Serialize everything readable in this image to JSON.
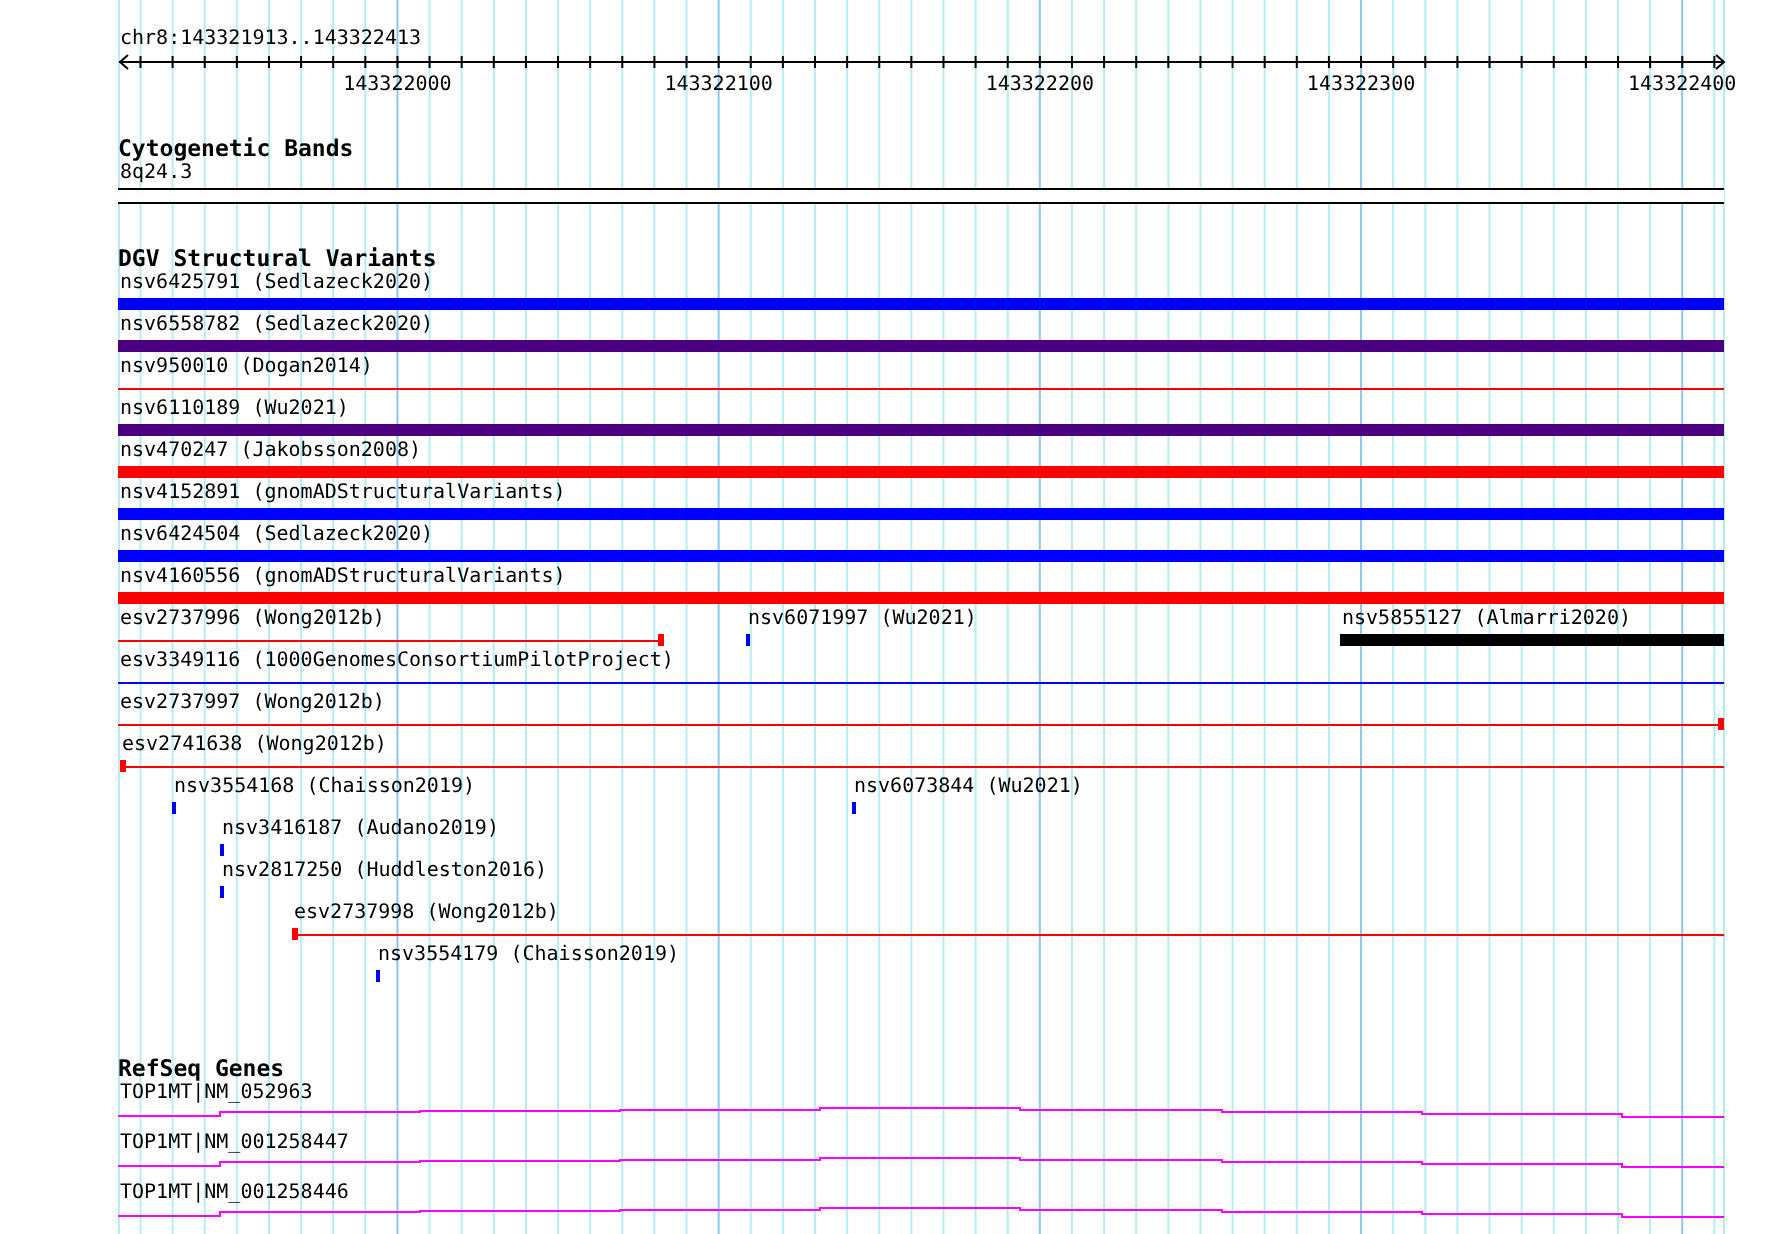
{
  "position": "chr8:143321913..143322413",
  "ruler": {
    "labels": [
      "143322000",
      "143322100",
      "143322200",
      "143322300",
      "143322400"
    ]
  },
  "tracks": [
    {
      "kind": "cytoband",
      "title": "Cytogenetic Bands",
      "items": [
        {
          "label": "8q24.3"
        }
      ]
    },
    {
      "kind": "variants",
      "title": "DGV Structural Variants",
      "rows": [
        {
          "features": [
            {
              "label": "nsv6425791 (Sedlazeck2020)",
              "kind": "bar",
              "color": "#0000ff"
            }
          ]
        },
        {
          "features": [
            {
              "label": "nsv6558782 (Sedlazeck2020)",
              "kind": "bar",
              "color": "#4b0082"
            }
          ]
        },
        {
          "features": [
            {
              "label": "nsv950010 (Dogan2014)",
              "kind": "line",
              "color": "#ff0000"
            }
          ]
        },
        {
          "features": [
            {
              "label": "nsv6110189 (Wu2021)",
              "kind": "bar",
              "color": "#4b0082"
            }
          ]
        },
        {
          "features": [
            {
              "label": "nsv470247 (Jakobsson2008)",
              "kind": "bar",
              "color": "#ff0000"
            }
          ]
        },
        {
          "features": [
            {
              "label": "nsv4152891 (gnomADStructuralVariants)",
              "kind": "bar",
              "color": "#0000ff"
            }
          ]
        },
        {
          "features": [
            {
              "label": "nsv6424504 (Sedlazeck2020)",
              "kind": "bar",
              "color": "#0000ff"
            }
          ]
        },
        {
          "features": [
            {
              "label": "nsv4160556 (gnomADStructuralVariants)",
              "kind": "bar",
              "color": "#ff0000"
            }
          ]
        },
        {
          "features": [
            {
              "label": "esv2737996 (Wong2012b)",
              "kind": "line",
              "color": "#ff0000"
            },
            {
              "label": "nsv6071997 (Wu2021)",
              "kind": "tick",
              "color": "#0000ff"
            },
            {
              "label": "nsv5855127 (Almarri2020)",
              "kind": "bar",
              "color": "#000000"
            }
          ]
        },
        {
          "features": [
            {
              "label": "esv3349116 (1000GenomesConsortiumPilotProject)",
              "kind": "line",
              "color": "#0000ff"
            }
          ]
        },
        {
          "features": [
            {
              "label": "esv2737997 (Wong2012b)",
              "kind": "line",
              "color": "#ff0000"
            }
          ]
        },
        {
          "features": [
            {
              "label": "esv2741638 (Wong2012b)",
              "kind": "line",
              "color": "#ff0000"
            }
          ]
        },
        {
          "features": [
            {
              "label": "nsv3554168 (Chaisson2019)",
              "kind": "tick",
              "color": "#0000ff"
            },
            {
              "label": "nsv6073844 (Wu2021)",
              "kind": "tick",
              "color": "#0000ff"
            }
          ]
        },
        {
          "features": [
            {
              "label": "nsv3416187 (Audano2019)",
              "kind": "tick",
              "color": "#0000ff"
            }
          ]
        },
        {
          "features": [
            {
              "label": "nsv2817250 (Huddleston2016)",
              "kind": "tick",
              "color": "#0000ff"
            }
          ]
        },
        {
          "features": [
            {
              "label": "esv2737998 (Wong2012b)",
              "kind": "line",
              "color": "#ff0000"
            }
          ]
        },
        {
          "features": [
            {
              "label": "nsv3554179 (Chaisson2019)",
              "kind": "tick",
              "color": "#0000ff"
            }
          ]
        }
      ]
    },
    {
      "kind": "genes",
      "title": "RefSeq Genes",
      "items": [
        {
          "label": "TOP1MT|NM_052963"
        },
        {
          "label": "TOP1MT|NM_001258447"
        },
        {
          "label": "TOP1MT|NM_001258446"
        }
      ]
    }
  ]
}
